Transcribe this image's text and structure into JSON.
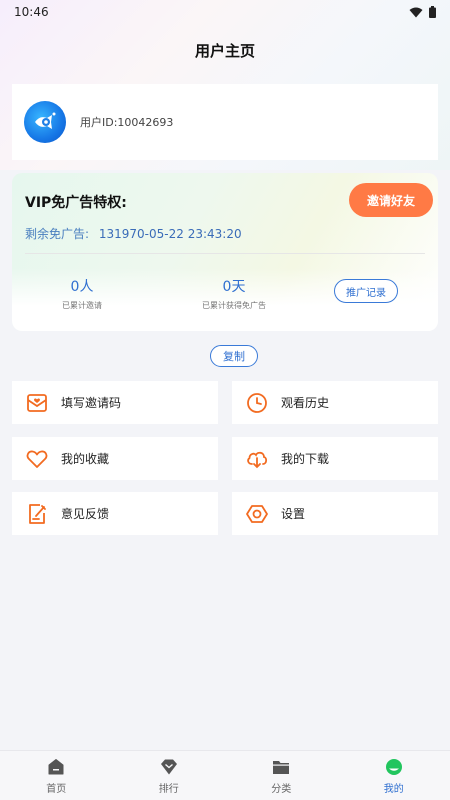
{
  "status_bar": {
    "time": "10:46"
  },
  "header": {
    "title": "用户主页"
  },
  "user": {
    "id_label": "用户ID:10042693"
  },
  "vip": {
    "title": "VIP免广告特权:",
    "invite_button": "邀请好友",
    "remaining_label": "剩余免广告:",
    "remaining_value": "131970-05-22 23:43:20",
    "stats": [
      {
        "value": "0人",
        "caption": "已累计邀请"
      },
      {
        "value": "0天",
        "caption": "已累计获得免广告"
      }
    ],
    "promo_button": "推广记录"
  },
  "copy_button": "复制",
  "menu": [
    {
      "label": "填写邀请码",
      "icon": "invite-code-icon"
    },
    {
      "label": "观看历史",
      "icon": "clock-icon"
    },
    {
      "label": "我的收藏",
      "icon": "heart-icon"
    },
    {
      "label": "我的下载",
      "icon": "cloud-download-icon"
    },
    {
      "label": "意见反馈",
      "icon": "feedback-edit-icon"
    },
    {
      "label": "设置",
      "icon": "settings-hexagon-icon"
    }
  ],
  "nav": [
    {
      "label": "首页",
      "icon": "home-icon"
    },
    {
      "label": "排行",
      "icon": "ranking-icon"
    },
    {
      "label": "分类",
      "icon": "folder-icon"
    },
    {
      "label": "我的",
      "icon": "profile-icon",
      "active": true
    }
  ],
  "colors": {
    "accent": "#2f6fd0",
    "invite": "#ff7a45",
    "icon_orange": "#f26b21"
  }
}
